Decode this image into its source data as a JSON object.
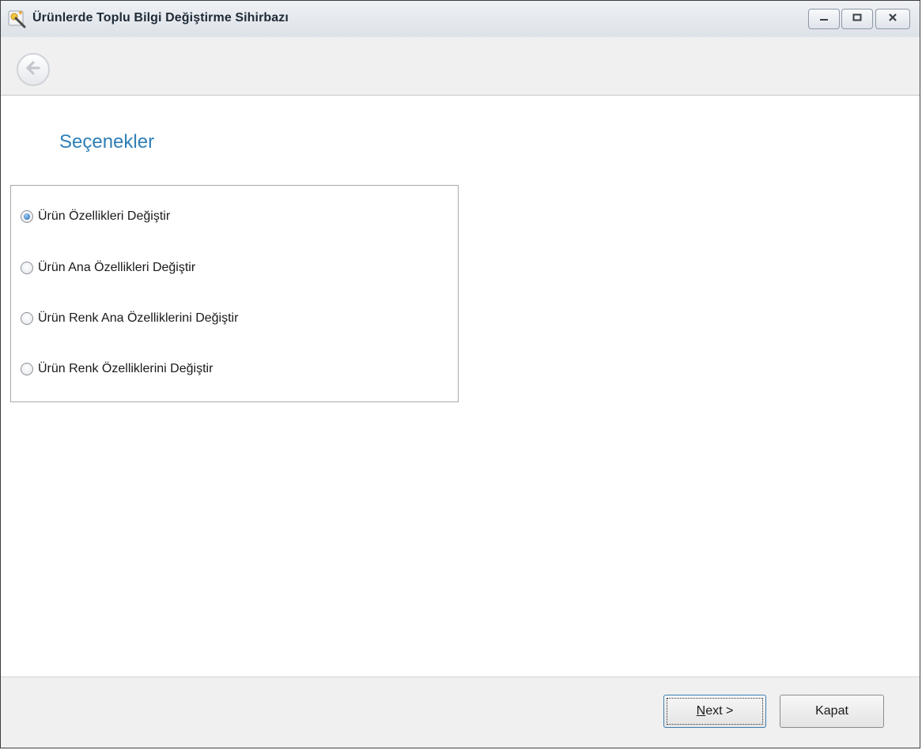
{
  "window": {
    "title": "Ürünlerde Toplu Bilgi Değiştirme Sihirbazı",
    "icon": "wizard-wand-icon"
  },
  "title_controls": {
    "minimize": "minimize-icon",
    "maximize": "maximize-icon",
    "close": "close-icon"
  },
  "nav": {
    "back_icon": "back-arrow-icon"
  },
  "page": {
    "heading": "Seçenekler"
  },
  "options": {
    "items": [
      {
        "label": "Ürün Özellikleri Değiştir",
        "checked": true
      },
      {
        "label": "Ürün Ana Özellikleri Değiştir",
        "checked": false
      },
      {
        "label": "Ürün Renk Ana Özelliklerini Değiştir",
        "checked": false
      },
      {
        "label": "Ürün Renk Özelliklerini Değiştir",
        "checked": false
      }
    ]
  },
  "footer": {
    "next_label_mnemonic": "N",
    "next_label_rest": "ext >",
    "close_label": "Kapat"
  },
  "colors": {
    "heading": "#2e7fb8",
    "radio_selected": "#3f82c7"
  }
}
